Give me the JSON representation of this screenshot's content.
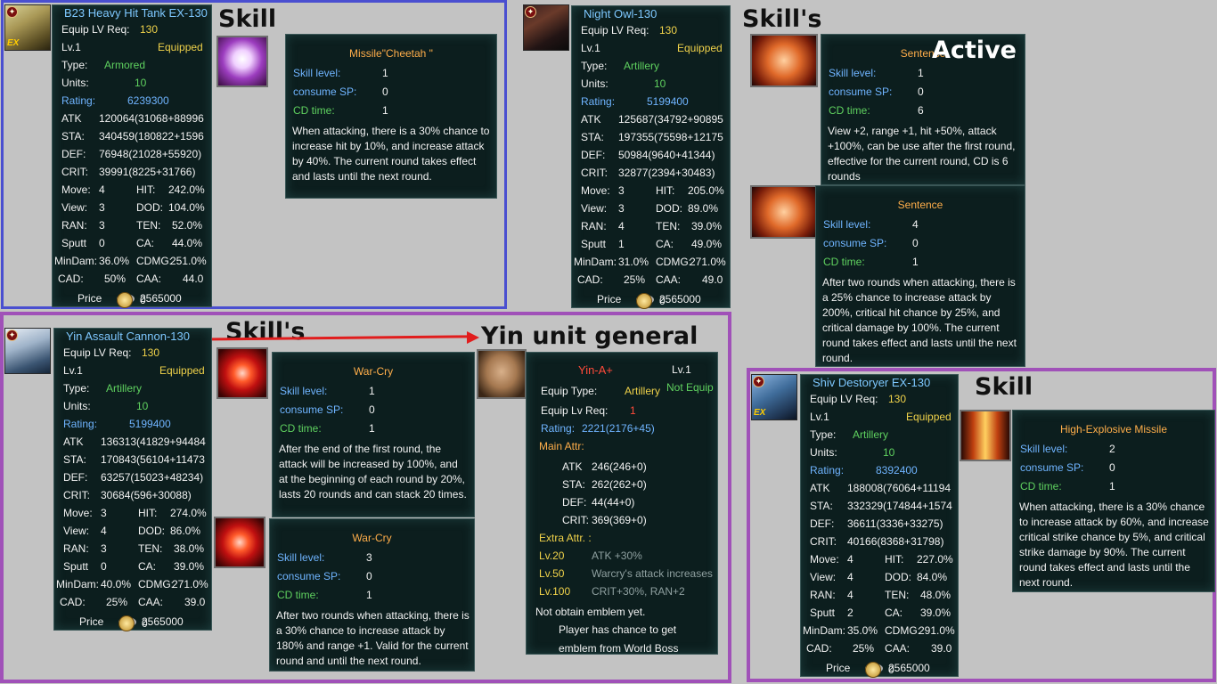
{
  "headings": {
    "tank_skill": "Skill",
    "owl_skills": "Skill's",
    "owl_active": "Active",
    "cannon_skills": "Skill's",
    "cannon_general": "Yin unit general",
    "shiv_skill": "Skill"
  },
  "labels": {
    "equip_lv_req": "Equip LV Req:",
    "type": "Type:",
    "units": "Units:",
    "rating": "Rating:",
    "atk": "ATK",
    "sta": "STA:",
    "def": "DEF:",
    "crit": "CRIT:",
    "move": "Move:",
    "hit": "HIT:",
    "view": "View:",
    "dod": "DOD:",
    "ran": "RAN:",
    "ten": "TEN:",
    "sputt": "Sputt",
    "ca": "CA:",
    "mindam": "MinDam:",
    "cdmg": "CDMG:",
    "cad": "CAD:",
    "caa": "CAA:",
    "price": "Price",
    "skill_level": "Skill level:",
    "consume_sp": "consume SP:",
    "cd_time": "CD time:"
  },
  "units": {
    "tank": {
      "name": "B23 Heavy Hit Tank EX-130",
      "req": "130",
      "lv": "Lv.1",
      "equipped": "Equipped",
      "type": "Armored",
      "units": "10",
      "rating": "6239300",
      "atk": "120064(31068+88996",
      "sta": "340459(180822+1596",
      "def": "76948(21028+55920)",
      "crit": "39991(8225+31766)",
      "move": "4",
      "hit": "242.0%",
      "view": "3",
      "dod": "104.0%",
      "ran": "3",
      "ten": "52.0%",
      "sputt": "0",
      "ca": "44.0%",
      "mindam": "36.0%",
      "cdmg": "251.0%",
      "cad": "50%",
      "caa": "44.0",
      "price": "2565000",
      "medals": "0"
    },
    "owl": {
      "name": "Night Owl-130",
      "req": "130",
      "lv": "Lv.1",
      "equipped": "Equipped",
      "type": "Artillery",
      "units": "10",
      "rating": "5199400",
      "atk": "125687(34792+90895",
      "sta": "197355(75598+12175",
      "def": "50984(9640+41344)",
      "crit": "32877(2394+30483)",
      "move": "3",
      "hit": "205.0%",
      "view": "3",
      "dod": "89.0%",
      "ran": "4",
      "ten": "39.0%",
      "sputt": "1",
      "ca": "49.0%",
      "mindam": "31.0%",
      "cdmg": "271.0%",
      "cad": "25%",
      "caa": "49.0",
      "price": "2565000",
      "medals": "0"
    },
    "cannon": {
      "name": "Yin Assault Cannon-130",
      "req": "130",
      "lv": "Lv.1",
      "equipped": "Equipped",
      "type": "Artillery",
      "units": "10",
      "rating": "5199400",
      "atk": "136313(41829+94484",
      "sta": "170843(56104+11473",
      "def": "63257(15023+48234)",
      "crit": "30684(596+30088)",
      "move": "3",
      "hit": "274.0%",
      "view": "4",
      "dod": "86.0%",
      "ran": "3",
      "ten": "38.0%",
      "sputt": "0",
      "ca": "39.0%",
      "mindam": "40.0%",
      "cdmg": "271.0%",
      "cad": "25%",
      "caa": "39.0",
      "price": "2565000",
      "medals": "0"
    },
    "shiv": {
      "name": "Shiv Destoryer EX-130",
      "req": "130",
      "lv": "Lv.1",
      "equipped": "Equipped",
      "type": "Artillery",
      "units": "10",
      "rating": "8392400",
      "atk": "188008(76064+11194",
      "sta": "332329(174844+1574",
      "def": "36611(3336+33275)",
      "crit": "40166(8368+31798)",
      "move": "4",
      "hit": "227.0%",
      "view": "4",
      "dod": "84.0%",
      "ran": "4",
      "ten": "48.0%",
      "sputt": "2",
      "ca": "39.0%",
      "mindam": "35.0%",
      "cdmg": "291.0%",
      "cad": "25%",
      "caa": "39.0",
      "price": "2565000",
      "medals": "0"
    }
  },
  "skills": {
    "cheetah": {
      "name": "Missile\"Cheetah \"",
      "level": "1",
      "sp": "0",
      "cd": "1",
      "desc": "When attacking, there is a 30% chance to increase hit by 10%, and increase attack by 40%. The current round takes effect and lasts until the next round."
    },
    "sentence1": {
      "name": "Sentence",
      "level": "1",
      "sp": "0",
      "cd": "6",
      "desc": "View +2, range +1, hit +50%, attack +100%, can be use after the first round, effective for the current round, CD is 6 rounds"
    },
    "sentence2": {
      "name": "Sentence",
      "level": "4",
      "sp": "0",
      "cd": "1",
      "desc": "After two rounds when attacking, there is a 25% chance to increase attack by 200%, critical hit chance by 25%, and critical damage by 100%. The current round takes effect and lasts until the next round."
    },
    "warcry1": {
      "name": "War-Cry",
      "level": "1",
      "sp": "0",
      "cd": "1",
      "desc": "After the end of the first round, the attack will be increased by 100%, and at the beginning of each round by 20%, lasts 20 rounds and can stack 20 times."
    },
    "warcry2": {
      "name": "War-Cry",
      "level": "3",
      "sp": "0",
      "cd": "1",
      "desc": "After two rounds when attacking, there is a 30% chance to increase attack by 180% and range +1. Valid for the current round and until the next round."
    },
    "he": {
      "name": "High-Explosive Missile",
      "level": "2",
      "sp": "0",
      "cd": "1",
      "desc": "When attacking, there is a 30% chance to increase attack by 60%, and increase critical strike chance by 5%, and critical strike damage by 90%. The current round takes effect and lasts until the next round."
    }
  },
  "general": {
    "name": "Yin-A+",
    "lv": "Lv.1",
    "equip_type_label": "Equip Type:",
    "equip_type": "Artillery",
    "not_equip": "Not Equip",
    "req_label": "Equip Lv Req:",
    "req": "1",
    "rating_label": "Rating:",
    "rating": "2221(2176+45)",
    "main_attr": "Main Attr:",
    "atk_label": "ATK",
    "atk": "246(246+0)",
    "sta_label": "STA:",
    "sta": "262(262+0)",
    "def_label": "DEF:",
    "def": "44(44+0)",
    "crit_label": "CRIT:",
    "crit": "369(369+0)",
    "extra_attr": "Extra Attr. :",
    "extras": [
      {
        "lv": "Lv.20",
        "text": "ATK +30%"
      },
      {
        "lv": "Lv.50",
        "text": "Warcry's attack increases"
      },
      {
        "lv": "Lv.100",
        "text": "CRIT+30%, RAN+2"
      }
    ],
    "emblem_note": "Not obtain emblem yet.",
    "emblem_line1": "Player has chance to get",
    "emblem_line2": "emblem from World Boss"
  },
  "colors": {
    "frame_blue": "#4a4fd0",
    "frame_purple": "#a051b8",
    "arrow_red": "#e11d1d",
    "panel_bg": "#0c1e1e"
  }
}
